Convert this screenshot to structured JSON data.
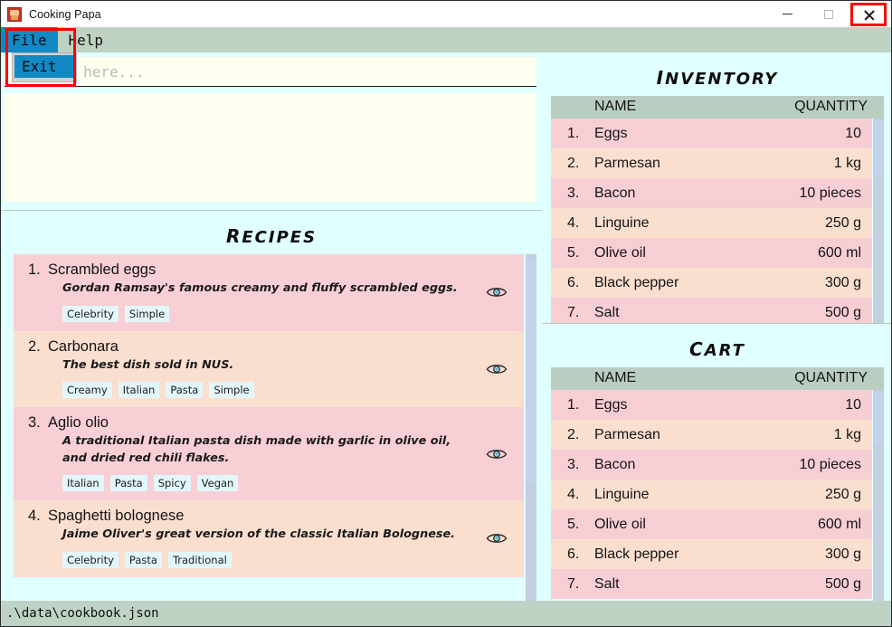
{
  "window": {
    "title": "Cooking Papa",
    "icon": "app-chef-icon",
    "minimize_label": "Minimize",
    "maximize_label": "Maximize",
    "close_label": "Close",
    "close_highlighted": true,
    "highlight_color": "#ff0000"
  },
  "menubar": {
    "items": [
      {
        "label": "File",
        "active": true
      },
      {
        "label": "Help",
        "active": false
      }
    ],
    "open_menu": "File",
    "dropdown": {
      "items": [
        {
          "label": "Exit"
        }
      ]
    },
    "highlight_color": "#ff0000",
    "active_color": "#1289c4"
  },
  "command": {
    "placeholder": "command here...",
    "value": "",
    "output": ""
  },
  "recipes": {
    "title": "Recipes",
    "items": [
      {
        "index": "1.",
        "name": "Scrambled eggs",
        "description": "Gordan Ramsay's famous creamy and fluffy scrambled eggs.",
        "tags": [
          "Celebrity",
          "Simple"
        ],
        "view_icon": "eye-icon"
      },
      {
        "index": "2.",
        "name": "Carbonara",
        "description": "The best dish sold in NUS.",
        "tags": [
          "Creamy",
          "Italian",
          "Pasta",
          "Simple"
        ],
        "view_icon": "eye-icon"
      },
      {
        "index": "3.",
        "name": "Aglio olio",
        "description": "A traditional Italian pasta dish made with garlic in olive oil, and dried red chili flakes.",
        "tags": [
          "Italian",
          "Pasta",
          "Spicy",
          "Vegan"
        ],
        "view_icon": "eye-icon"
      },
      {
        "index": "4.",
        "name": "Spaghetti bolognese",
        "description": "Jaime Oliver's great version of the classic Italian Bolognese.",
        "tags": [
          "Celebrity",
          "Pasta",
          "Traditional"
        ],
        "view_icon": "eye-icon"
      }
    ]
  },
  "inventory": {
    "title": "Inventory",
    "columns": {
      "index": "",
      "name": "NAME",
      "quantity": "QUANTITY"
    },
    "rows": [
      {
        "index": "1.",
        "name": "Eggs",
        "quantity": "10"
      },
      {
        "index": "2.",
        "name": "Parmesan",
        "quantity": "1 kg"
      },
      {
        "index": "3.",
        "name": "Bacon",
        "quantity": "10 pieces"
      },
      {
        "index": "4.",
        "name": "Linguine",
        "quantity": "250 g"
      },
      {
        "index": "5.",
        "name": "Olive oil",
        "quantity": "600 ml"
      },
      {
        "index": "6.",
        "name": "Black pepper",
        "quantity": "300 g"
      },
      {
        "index": "7.",
        "name": "Salt",
        "quantity": "500 g"
      }
    ]
  },
  "cart": {
    "title": "Cart",
    "columns": {
      "index": "",
      "name": "NAME",
      "quantity": "QUANTITY"
    },
    "rows": [
      {
        "index": "1.",
        "name": "Eggs",
        "quantity": "10"
      },
      {
        "index": "2.",
        "name": "Parmesan",
        "quantity": "1 kg"
      },
      {
        "index": "3.",
        "name": "Bacon",
        "quantity": "10 pieces"
      },
      {
        "index": "4.",
        "name": "Linguine",
        "quantity": "250 g"
      },
      {
        "index": "5.",
        "name": "Olive oil",
        "quantity": "600 ml"
      },
      {
        "index": "6.",
        "name": "Black pepper",
        "quantity": "300 g"
      },
      {
        "index": "7.",
        "name": "Salt",
        "quantity": "500 g"
      }
    ]
  },
  "statusbar": {
    "file_path": ".\\data\\cookbook.json"
  },
  "colors": {
    "accent": "#1289c4",
    "menubar": "#bed3c3",
    "panel_bg": "#e0ffff",
    "row_odd": "#f7ced4",
    "row_even": "#fadfcf",
    "table_header": "#b9cdc0",
    "input_bg": "#fffff0",
    "tag_bg": "#e3f7fb",
    "scrollbar": "#c3d3ec"
  }
}
